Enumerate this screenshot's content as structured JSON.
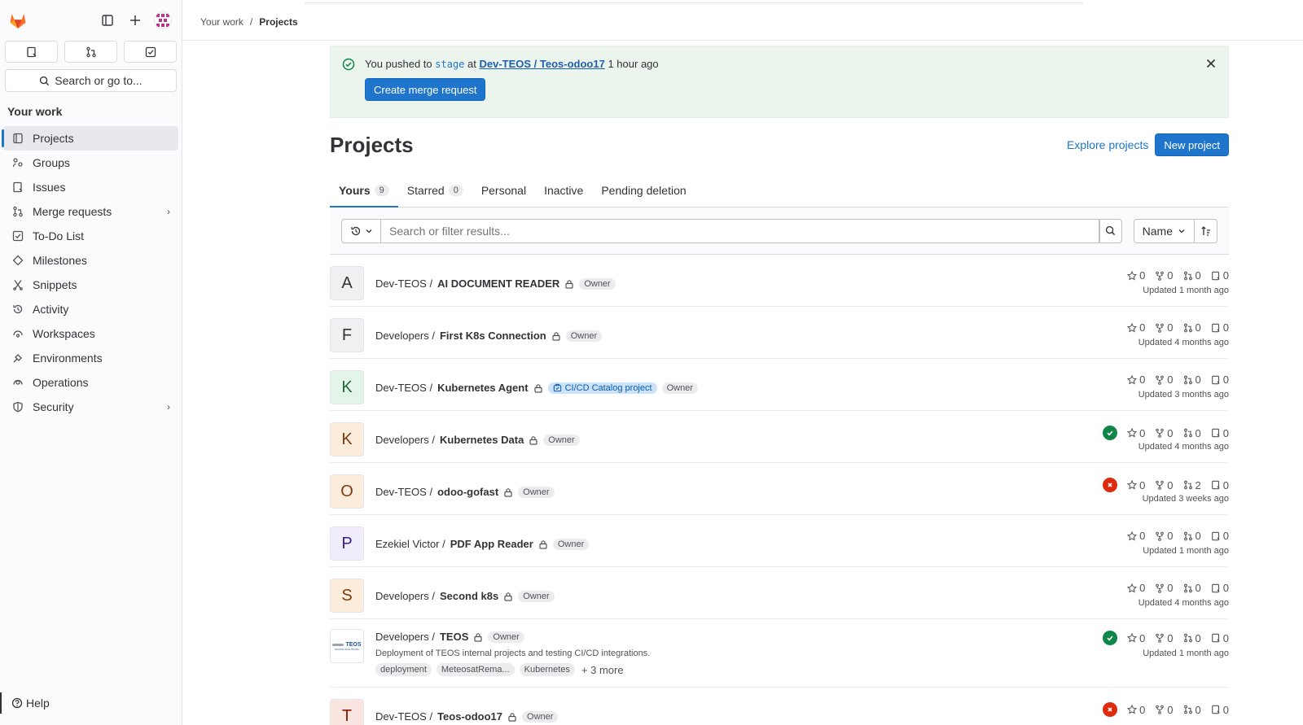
{
  "sidebar": {
    "search_label": "Search or go to...",
    "section_title": "Your work",
    "items": [
      {
        "label": "Projects",
        "icon": "project-icon"
      },
      {
        "label": "Groups",
        "icon": "group-icon"
      },
      {
        "label": "Issues",
        "icon": "issues-icon"
      },
      {
        "label": "Merge requests",
        "icon": "merge-request-icon"
      },
      {
        "label": "To-Do List",
        "icon": "todo-icon"
      },
      {
        "label": "Milestones",
        "icon": "milestone-icon"
      },
      {
        "label": "Snippets",
        "icon": "snippet-icon"
      },
      {
        "label": "Activity",
        "icon": "history-icon"
      },
      {
        "label": "Workspaces",
        "icon": "workspace-icon"
      },
      {
        "label": "Environments",
        "icon": "environment-icon"
      },
      {
        "label": "Operations",
        "icon": "cloud-gear-icon"
      },
      {
        "label": "Security",
        "icon": "shield-icon"
      }
    ],
    "help_label": "Help"
  },
  "breadcrumb": {
    "root": "Your work",
    "separator": "/",
    "current": "Projects"
  },
  "banner": {
    "prefix": "You pushed to",
    "branch": "stage",
    "at": "at",
    "project_link": "Dev-TEOS / Teos-odoo17",
    "time": "1 hour ago",
    "button": "Create merge request"
  },
  "page": {
    "title": "Projects",
    "explore_label": "Explore projects",
    "new_label": "New project"
  },
  "tabs": [
    {
      "label": "Yours",
      "count": "9"
    },
    {
      "label": "Starred",
      "count": "0"
    },
    {
      "label": "Personal"
    },
    {
      "label": "Inactive"
    },
    {
      "label": "Pending deletion"
    }
  ],
  "filter": {
    "placeholder": "Search or filter results...",
    "sort_label": "Name"
  },
  "projects": [
    {
      "letter": "A",
      "ns": "Dev-TEOS /",
      "name": "AI DOCUMENT READER",
      "role": "Owner",
      "stars": "0",
      "forks": "0",
      "mrs": "0",
      "issues": "0",
      "updated": "Updated 1 month ago"
    },
    {
      "letter": "F",
      "ns": "Developers /",
      "name": "First K8s Connection",
      "role": "Owner",
      "stars": "0",
      "forks": "0",
      "mrs": "0",
      "issues": "0",
      "updated": "Updated 4 months ago"
    },
    {
      "letter": "K",
      "ns": "Dev-TEOS /",
      "name": "Kubernetes Agent",
      "catalog": "CI/CD Catalog project",
      "role": "Owner",
      "stars": "0",
      "forks": "0",
      "mrs": "0",
      "issues": "0",
      "updated": "Updated 3 months ago"
    },
    {
      "letter": "K",
      "ns": "Developers /",
      "name": "Kubernetes Data",
      "role": "Owner",
      "stars": "0",
      "forks": "0",
      "mrs": "0",
      "issues": "0",
      "updated": "Updated 4 months ago",
      "pipeline": "passed"
    },
    {
      "letter": "O",
      "ns": "Dev-TEOS /",
      "name": "odoo-gofast",
      "role": "Owner",
      "stars": "0",
      "forks": "0",
      "mrs": "2",
      "issues": "0",
      "updated": "Updated 3 weeks ago",
      "pipeline": "failed"
    },
    {
      "letter": "P",
      "ns": "Ezekiel Victor /",
      "name": "PDF App Reader",
      "role": "Owner",
      "stars": "0",
      "forks": "0",
      "mrs": "0",
      "issues": "0",
      "updated": "Updated 1 month ago"
    },
    {
      "letter": "S",
      "ns": "Developers /",
      "name": "Second k8s",
      "role": "Owner",
      "stars": "0",
      "forks": "0",
      "mrs": "0",
      "issues": "0",
      "updated": "Updated 4 months ago"
    },
    {
      "ns": "Developers /",
      "name": "TEOS",
      "role": "Owner",
      "description": "Deployment of TEOS internal projects and testing CI/CD integrations.",
      "topics": [
        "deployment",
        "MeteosatRema...",
        "Kubernetes"
      ],
      "more_topics": "+ 3 more",
      "logo_text": "TEOS",
      "logo_subtext": "DIGITAL SOLUTIONS",
      "stars": "0",
      "forks": "0",
      "mrs": "0",
      "issues": "0",
      "updated": "Updated 1 month ago",
      "pipeline": "passed"
    },
    {
      "letter": "T",
      "ns": "Dev-TEOS /",
      "name": "Teos-odoo17",
      "role": "Owner",
      "stars": "0",
      "forks": "0",
      "mrs": "0",
      "issues": "0",
      "pipeline": "failed"
    }
  ],
  "colors": {
    "primary": "#1f75cb",
    "banner_bg": "#ecf4ee",
    "success": "#108548",
    "danger": "#dd2b0e"
  }
}
